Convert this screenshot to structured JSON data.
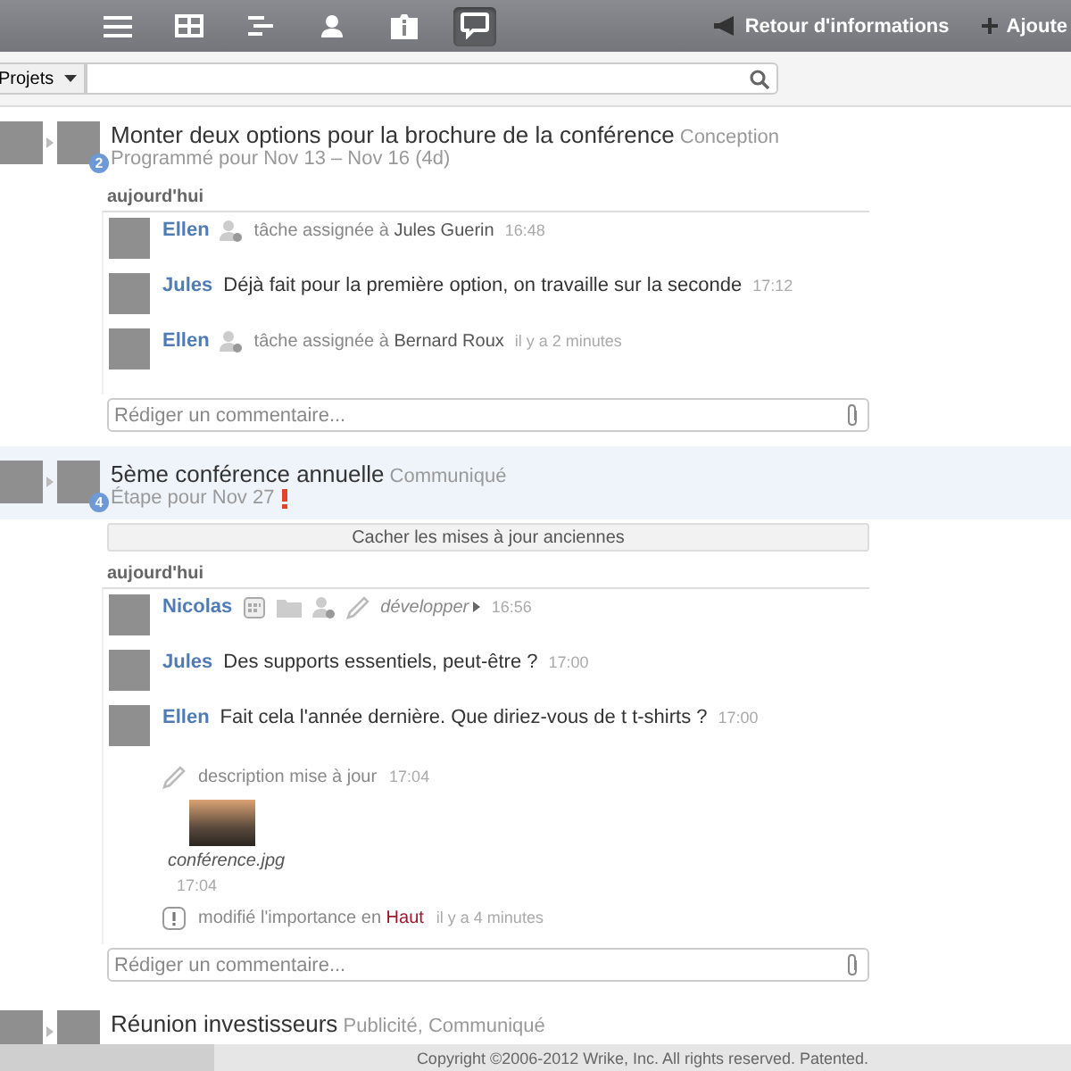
{
  "toolbar": {
    "icons": [
      {
        "kind": "list",
        "selected": false
      },
      {
        "kind": "grid",
        "selected": false
      },
      {
        "kind": "gantt",
        "selected": false
      },
      {
        "kind": "person",
        "selected": false
      },
      {
        "kind": "info",
        "selected": false
      },
      {
        "kind": "chat",
        "selected": true
      }
    ],
    "links": [
      {
        "kind": "feedback",
        "label": "Retour d'informations"
      },
      {
        "kind": "add",
        "label": "Ajoute"
      }
    ]
  },
  "filter": {
    "dropdown": "Projets"
  },
  "tasks": [
    {
      "title": "Monter deux options pour la brochure de la conférence",
      "tag": "Conception",
      "schedule": "Programmé pour Nov 13 – Nov 16 (4d)",
      "important": false,
      "badge": "2",
      "selected": false,
      "day": "aujourd'hui",
      "entries": [
        {
          "kind": "assign",
          "author": "Ellen",
          "text": "tâche assignée à",
          "target": "Jules Guerin",
          "time": "16:48"
        },
        {
          "kind": "comment",
          "author": "Jules",
          "text": "Déjà fait pour la première option, on travaille sur la seconde",
          "time": "17:12"
        },
        {
          "kind": "assign",
          "author": "Ellen",
          "text": "tâche assignée à",
          "target": "Bernard Roux",
          "time": "il y a 2 minutes"
        }
      ],
      "comment_placeholder": "Rédiger un commentaire..."
    },
    {
      "title": "5ème conférence annuelle",
      "tag": "Communiqué",
      "schedule": "Étape pour Nov 27",
      "important": true,
      "badge": "4",
      "selected": true,
      "hide_button": "Cacher les mises à jour anciennes",
      "day": "aujourd'hui",
      "entries": [
        {
          "kind": "activity",
          "author": "Nicolas",
          "link": "développer",
          "time": "16:56"
        },
        {
          "kind": "comment",
          "author": "Jules",
          "text": "Des supports essentiels, peut-être ?",
          "time": "17:00"
        },
        {
          "kind": "comment",
          "author": "Ellen",
          "text": "Fait cela l'année dernière. Que diriez-vous de t t-shirts ?",
          "time": "17:00"
        },
        {
          "kind": "description",
          "text": "description mise à jour",
          "time": "17:04"
        },
        {
          "kind": "attachment",
          "filename": "conférence.jpg",
          "time": "17:04"
        },
        {
          "kind": "importance",
          "text": "modifié l'importance en",
          "value": "Haut",
          "time": "il y a 4 minutes"
        }
      ],
      "comment_placeholder": "Rédiger un commentaire..."
    },
    {
      "title": "Réunion investisseurs",
      "tag": "Publicité, Communiqué",
      "selected": false
    }
  ],
  "footer": "Copyright ©2006-2012 Wrike, Inc. All rights reserved. Patented."
}
